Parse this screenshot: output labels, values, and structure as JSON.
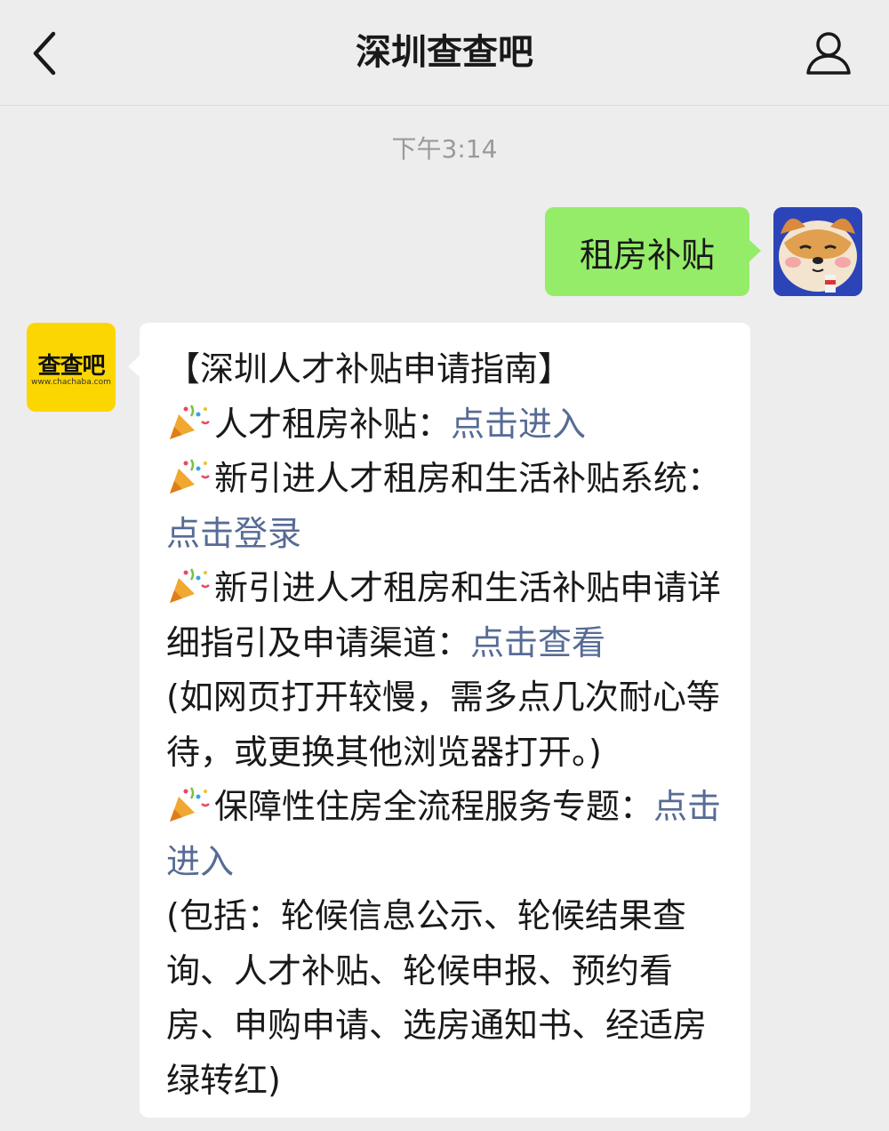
{
  "header": {
    "title": "深圳查查吧",
    "back_icon": "chevron-left-icon",
    "profile_icon": "user-icon"
  },
  "chat": {
    "timestamp": "下午3:14",
    "outgoing": {
      "text": "租房补贴"
    },
    "incoming": {
      "bot_logo": "查查吧",
      "bot_logo_url": "www.chachaba.com",
      "title": "【深圳人才补贴申请指南】",
      "item1_text": "人才租房补贴：",
      "item1_link": "点击进入",
      "item2_text": "新引进人才租房和生活补贴系统：",
      "item2_link": "点击登录",
      "item3_text": "新引进人才租房和生活补贴申请详细指引及申请渠道：",
      "item3_link": "点击查看",
      "note1": "(如网页打开较慢，需多点几次耐心等待，或更换其他浏览器打开。)",
      "item4_text": "保障性住房全流程服务专题：",
      "item4_link": "点击进入",
      "note2": "(包括：轮候信息公示、轮候结果查询、人才补贴、轮候申报、预约看房、申购申请、选房通知书、经适房绿转红)"
    }
  },
  "colors": {
    "background": "#ededed",
    "outgoing_bubble": "#95ec69",
    "incoming_bubble": "#ffffff",
    "link": "#576b95",
    "bot_avatar": "#fcd600"
  }
}
